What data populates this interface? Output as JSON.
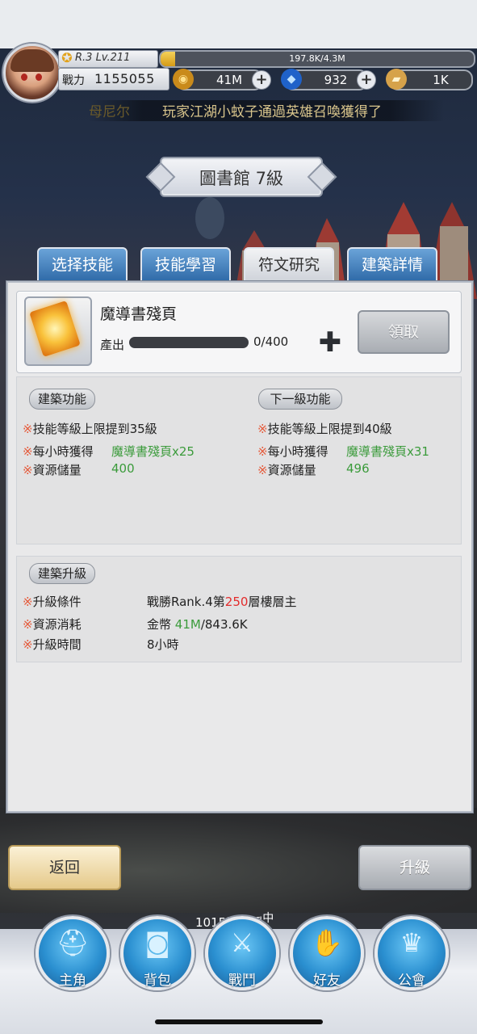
{
  "top": {
    "rank_level": "R.3 Lv.211",
    "exp_text": "197.8K/4.3M",
    "exp_fraction": 0.046,
    "power_label": "戰力",
    "power_value": "1155055",
    "gold": "41M",
    "gems": "932",
    "tickets": "1K",
    "ticker_name": "母尼尔",
    "ticker_text": "玩家江湖小蚊子通過英雄召喚獲得了"
  },
  "building": {
    "title": "圖書館 7級"
  },
  "tabs": [
    "选择技能",
    "技能學習",
    "符文研究",
    "建築詳情"
  ],
  "active_tab": 3,
  "item": {
    "name": "魔導書殘頁",
    "output_label": "產出",
    "output_value": "0/400",
    "output_fraction": 0,
    "claim_label": "領取"
  },
  "current_function": {
    "title": "建築功能",
    "lines": [
      {
        "label": "技能等級上限提到35級",
        "value": ""
      },
      {
        "label": "每小時獲得",
        "value": "魔導書殘頁x25"
      },
      {
        "label": "資源儲量",
        "value": "400"
      }
    ]
  },
  "next_function": {
    "title": "下一級功能",
    "lines": [
      {
        "label": "技能等級上限提到40級",
        "value": ""
      },
      {
        "label": "每小時獲得",
        "value": "魔導書殘頁x31"
      },
      {
        "label": "資源儲量",
        "value": "496"
      }
    ]
  },
  "upgrade": {
    "title": "建築升級",
    "condition_label": "升級條件",
    "condition_prefix": "戰勝Rank.4第",
    "condition_floor": "250",
    "condition_suffix": "層樓層主",
    "cost_label": "資源消耗",
    "cost_prefix": "金幣 ",
    "cost_have": "41M",
    "cost_need": "/843.6K",
    "time_label": "升級時間",
    "time_value": "8小時"
  },
  "buttons": {
    "back": "返回",
    "upgrade": "升級"
  },
  "floor_status": {
    "text": "1015層戰鬥",
    "sup": "中"
  },
  "nav": [
    "主角",
    "背包",
    "戰鬥",
    "好友",
    "公會"
  ],
  "mark_symbol": "※",
  "colors": {
    "accent_green": "#3b9b3b",
    "accent_red": "#e32b2b",
    "tab_blue": "#2f6aa8"
  },
  "icons": [
    "gold-coin-icon",
    "gem-icon",
    "ticket-icon",
    "scroll-icon",
    "plus-icon",
    "helmet-icon",
    "bag-icon",
    "swords-icon",
    "handshake-icon",
    "guild-crest-icon"
  ]
}
